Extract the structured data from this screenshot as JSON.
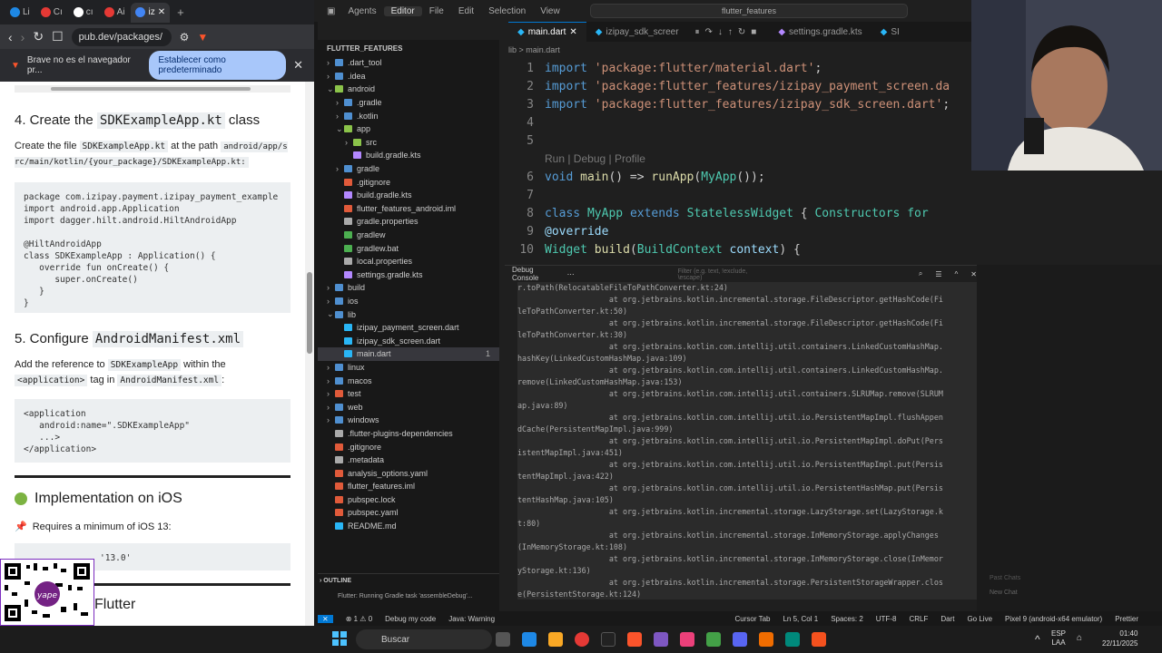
{
  "browser": {
    "tabs": [
      "Li",
      "Cı",
      "cı",
      "Ai",
      "iz"
    ],
    "url": "pub.dev/packages/",
    "infobar_text": "Brave no es el navegador pr...",
    "infobar_button": "Establecer como predeterminado",
    "doc": {
      "h4_prefix": "4. Create the",
      "h4_code": "SDKExampleApp.kt",
      "h4_suffix": "class",
      "p1_prefix": "Create the file",
      "p1_code": "SDKExampleApp.kt",
      "p1_suffix": "at the path",
      "p1_path": "android/app/src/main/kotlin/{your_package}/SDKExampleApp.kt:",
      "code1": "package com.izipay.payment.izipay_payment_example\nimport android.app.Application\nimport dagger.hilt.android.HiltAndroidApp\n\n@HiltAndroidApp\nclass SDKExampleApp : Application() {\n   override fun onCreate() {\n      super.onCreate()\n   }\n}",
      "h5_prefix": "5. Configure",
      "h5_code": "AndroidManifest.xml",
      "p2_prefix": "Add the reference to",
      "p2_code": "SDKExampleApp",
      "p2_suffix": "within the",
      "p2_code2": "<application>",
      "p2_suffix2": "tag in",
      "p2_code3": "AndroidManifest.xml",
      "code2": "<application\n   android:name=\".SDKExampleApp\"\n   ...>\n</application>",
      "ios_title": "Implementation on iOS",
      "ios_req": "Requires a minimum of iOS 13:",
      "ios_code": "'13.0'",
      "next_heading": "Flutter"
    }
  },
  "ide": {
    "menus": [
      "Agents",
      "Editor",
      "File",
      "Edit",
      "Selection",
      "View"
    ],
    "command_center": "flutter_features",
    "explorer_title": "FLUTTER_FEATURES",
    "tree": [
      {
        "label": ".dart_tool",
        "indent": 1,
        "color": "#4f8fd0"
      },
      {
        "label": ".idea",
        "indent": 1,
        "color": "#4f8fd0"
      },
      {
        "label": "android",
        "indent": 1,
        "color": "#8bc34a"
      },
      {
        "label": ".gradle",
        "indent": 2,
        "color": "#4f8fd0"
      },
      {
        "label": ".kotlin",
        "indent": 2,
        "color": "#4f8fd0"
      },
      {
        "label": "app",
        "indent": 2,
        "color": "#8bc34a"
      },
      {
        "label": "src",
        "indent": 3,
        "color": "#8bc34a"
      },
      {
        "label": "build.gradle.kts",
        "indent": 3,
        "color": "#b388ff"
      },
      {
        "label": "gradle",
        "indent": 2,
        "color": "#4f8fd0"
      },
      {
        "label": ".gitignore",
        "indent": 2,
        "color": "#e05a3a"
      },
      {
        "label": "build.gradle.kts",
        "indent": 2,
        "color": "#b388ff"
      },
      {
        "label": "flutter_features_android.iml",
        "indent": 2,
        "color": "#e05a3a"
      },
      {
        "label": "gradle.properties",
        "indent": 2,
        "color": "#aaa"
      },
      {
        "label": "gradlew",
        "indent": 2,
        "color": "#4caf50"
      },
      {
        "label": "gradlew.bat",
        "indent": 2,
        "color": "#4caf50"
      },
      {
        "label": "local.properties",
        "indent": 2,
        "color": "#aaa"
      },
      {
        "label": "settings.gradle.kts",
        "indent": 2,
        "color": "#b388ff"
      },
      {
        "label": "build",
        "indent": 1,
        "color": "#4f8fd0"
      },
      {
        "label": "ios",
        "indent": 1,
        "color": "#4f8fd0"
      },
      {
        "label": "lib",
        "indent": 1,
        "color": "#4f8fd0"
      },
      {
        "label": "izipay_payment_screen.dart",
        "indent": 2,
        "color": "#29b6f6"
      },
      {
        "label": "izipay_sdk_screen.dart",
        "indent": 2,
        "color": "#29b6f6"
      },
      {
        "label": "main.dart",
        "indent": 2,
        "color": "#29b6f6"
      },
      {
        "label": "linux",
        "indent": 1,
        "color": "#4f8fd0"
      },
      {
        "label": "macos",
        "indent": 1,
        "color": "#4f8fd0"
      },
      {
        "label": "test",
        "indent": 1,
        "color": "#e05a3a"
      },
      {
        "label": "web",
        "indent": 1,
        "color": "#4f8fd0"
      },
      {
        "label": "windows",
        "indent": 1,
        "color": "#4f8fd0"
      },
      {
        "label": ".flutter-plugins-dependencies",
        "indent": 1,
        "color": "#aaa"
      },
      {
        "label": ".gitignore",
        "indent": 1,
        "color": "#e05a3a"
      },
      {
        "label": ".metadata",
        "indent": 1,
        "color": "#aaa"
      },
      {
        "label": "analysis_options.yaml",
        "indent": 1,
        "color": "#e05a3a"
      },
      {
        "label": "flutter_features.iml",
        "indent": 1,
        "color": "#e05a3a"
      },
      {
        "label": "pubspec.lock",
        "indent": 1,
        "color": "#e05a3a"
      },
      {
        "label": "pubspec.yaml",
        "indent": 1,
        "color": "#e05a3a"
      },
      {
        "label": "README.md",
        "indent": 1,
        "color": "#29b6f6"
      }
    ],
    "main_badge": "1",
    "outline": "OUTLINE",
    "running_task": "Flutter: Running Gradle task 'assembleDebug'...",
    "editor_tabs": [
      "main.dart",
      "izipay_sdk_screer",
      "settings.gradle.kts",
      "SI"
    ],
    "breadcrumb": "lib > main.dart",
    "codelens": "Run | Debug | Profile",
    "code_lines": [
      {
        "n": "1",
        "html": "<span class='k'>import</span> <span class='s'>'package:flutter/material.dart'</span>;"
      },
      {
        "n": "2",
        "html": "<span class='k'>import</span> <span class='s'>'package:flutter_features/izipay_payment_screen.da</span>"
      },
      {
        "n": "3",
        "html": "<span class='k'>import</span> <span class='s'>'package:flutter_features/izipay_sdk_screen.dart'</span>;"
      },
      {
        "n": "4",
        "html": ""
      },
      {
        "n": "5",
        "html": ""
      },
      {
        "n": "",
        "html": "<span style='color:#777;font-family:Liberation Sans,sans-serif;font-size:12px'>Run | Debug | Profile</span>"
      },
      {
        "n": "6",
        "html": "<span class='k'>void</span> <span class='f'>main</span>() => <span class='f'>runApp</span>(<span class='t'>MyApp</span>());"
      },
      {
        "n": "7",
        "html": ""
      },
      {
        "n": "8",
        "html": "<span class='k'>class</span> <span class='t'>MyApp</span> <span class='k'>extends</span> <span class='t'>StatelessWidget</span> {   <span class='t'>Constructors for</span>"
      },
      {
        "n": "9",
        "html": "  <span class='v'>@override</span>"
      },
      {
        "n": "10",
        "html": "  <span class='t'>Widget</span> <span class='f'>build</span>(<span class='t'>BuildContext</span> <span class='v'>context</span>) {"
      }
    ],
    "console_title": "Debug Console",
    "console_filter": "Filter (e.g. text, !exclude, \\escape)",
    "console_lines": [
      "r.toPath(RelocatableFileToPathConverter.kt:24)",
      "                    at org.jetbrains.kotlin.incremental.storage.FileDescriptor.getHashCode(Fi",
      "leToPathConverter.kt:50)",
      "                    at org.jetbrains.kotlin.incremental.storage.FileDescriptor.getHashCode(Fi",
      "leToPathConverter.kt:30)",
      "                    at org.jetbrains.kotlin.com.intellij.util.containers.LinkedCustomHashMap.",
      "hashKey(LinkedCustomHashMap.java:109)",
      "                    at org.jetbrains.kotlin.com.intellij.util.containers.LinkedCustomHashMap.",
      "remove(LinkedCustomHashMap.java:153)",
      "                    at org.jetbrains.kotlin.com.intellij.util.containers.SLRUMap.remove(SLRUM",
      "ap.java:89)",
      "                    at org.jetbrains.kotlin.com.intellij.util.io.PersistentMapImpl.flushAppen",
      "dCache(PersistentMapImpl.java:999)",
      "                    at org.jetbrains.kotlin.com.intellij.util.io.PersistentMapImpl.doPut(Pers",
      "istentMapImpl.java:451)",
      "                    at org.jetbrains.kotlin.com.intellij.util.io.PersistentMapImpl.put(Persis",
      "tentMapImpl.java:422)",
      "                    at org.jetbrains.kotlin.com.intellij.util.io.PersistentHashMap.put(Persis",
      "tentHashMap.java:105)",
      "                    at org.jetbrains.kotlin.incremental.storage.LazyStorage.set(LazyStorage.k",
      "t:80)",
      "                    at org.jetbrains.kotlin.incremental.storage.InMemoryStorage.applyChanges",
      "(InMemoryStorage.kt:108)",
      "                    at org.jetbrains.kotlin.incremental.storage.InMemoryStorage.close(InMemor",
      "yStorage.kt:136)",
      "                    at org.jetbrains.kotlin.incremental.storage.PersistentStorageWrapper.clos",
      "e(PersistentStorage.kt:124)"
    ],
    "right_labels": [
      "Past Chats",
      "New Chat"
    ],
    "status": {
      "errors": "⊗ 1 ⚠ 0",
      "debug": "Debug my code",
      "java": "Java: Warning",
      "cursor_tab": "Cursor Tab",
      "position": "Ln 5, Col 1",
      "spaces": "Spaces: 2",
      "encoding": "UTF-8",
      "eol": "CRLF",
      "lang": "Dart",
      "golive": "Go Live",
      "device": "Pixel 9 (android-x64 emulator)",
      "prettier": "Prettier"
    }
  },
  "taskbar": {
    "search": "Buscar",
    "lang": "ESP",
    "region": "LAA",
    "time": "01:40",
    "date": "22/11/2025"
  }
}
